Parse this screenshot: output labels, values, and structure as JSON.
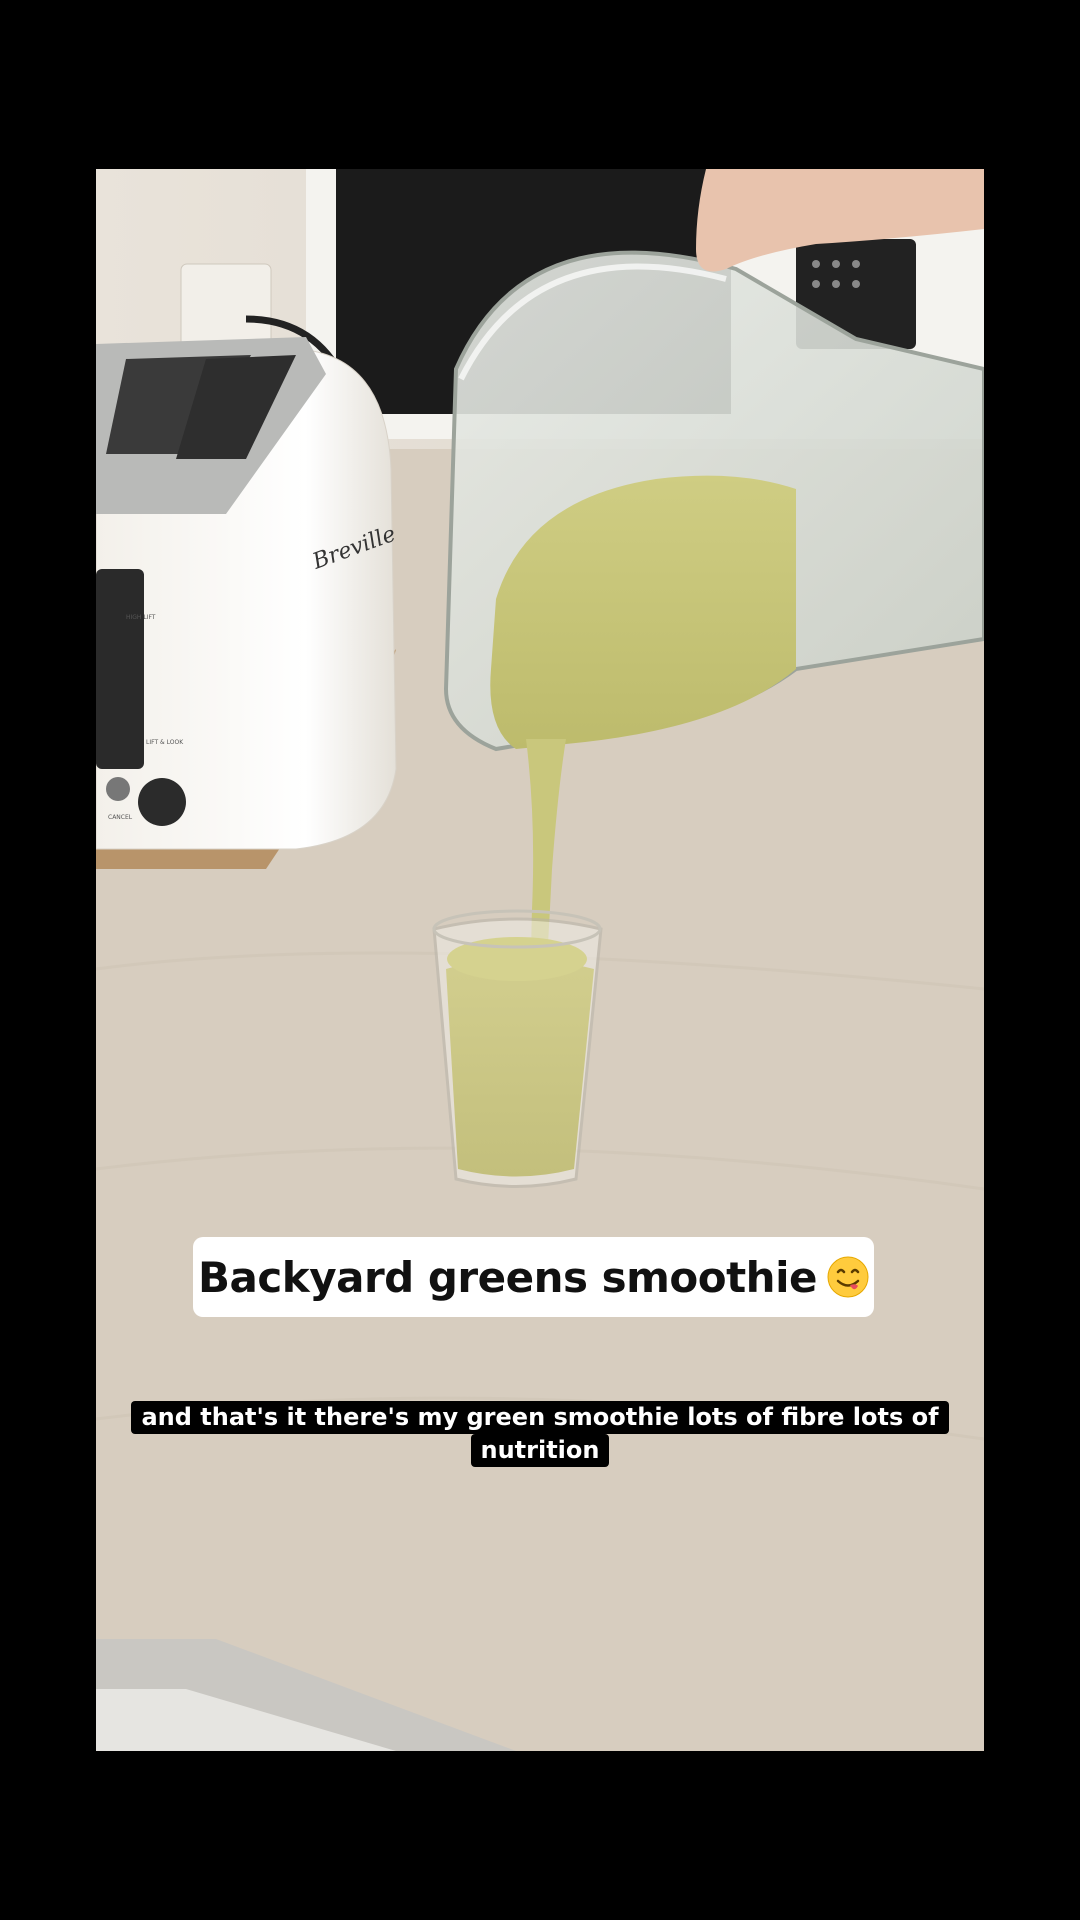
{
  "overlay": {
    "title": "Backyard greens smoothie",
    "title_emoji_icon": "face-savoring-food-icon",
    "caption_line1": "and that's it there's my green smoothie lots of fibre lots of",
    "caption_line2": "nutrition"
  },
  "scene": {
    "toaster_brand": "Breville",
    "toaster_labels": {
      "high_lift": "HIGH LIFT",
      "lift_look": "LIFT & LOOK",
      "cancel": "CANCEL"
    }
  },
  "colors": {
    "background": "#000000",
    "countertop": "#d8cdbf",
    "smoothie": "#c7c67a",
    "title_box": "#ffffff",
    "caption_box": "#000000"
  }
}
